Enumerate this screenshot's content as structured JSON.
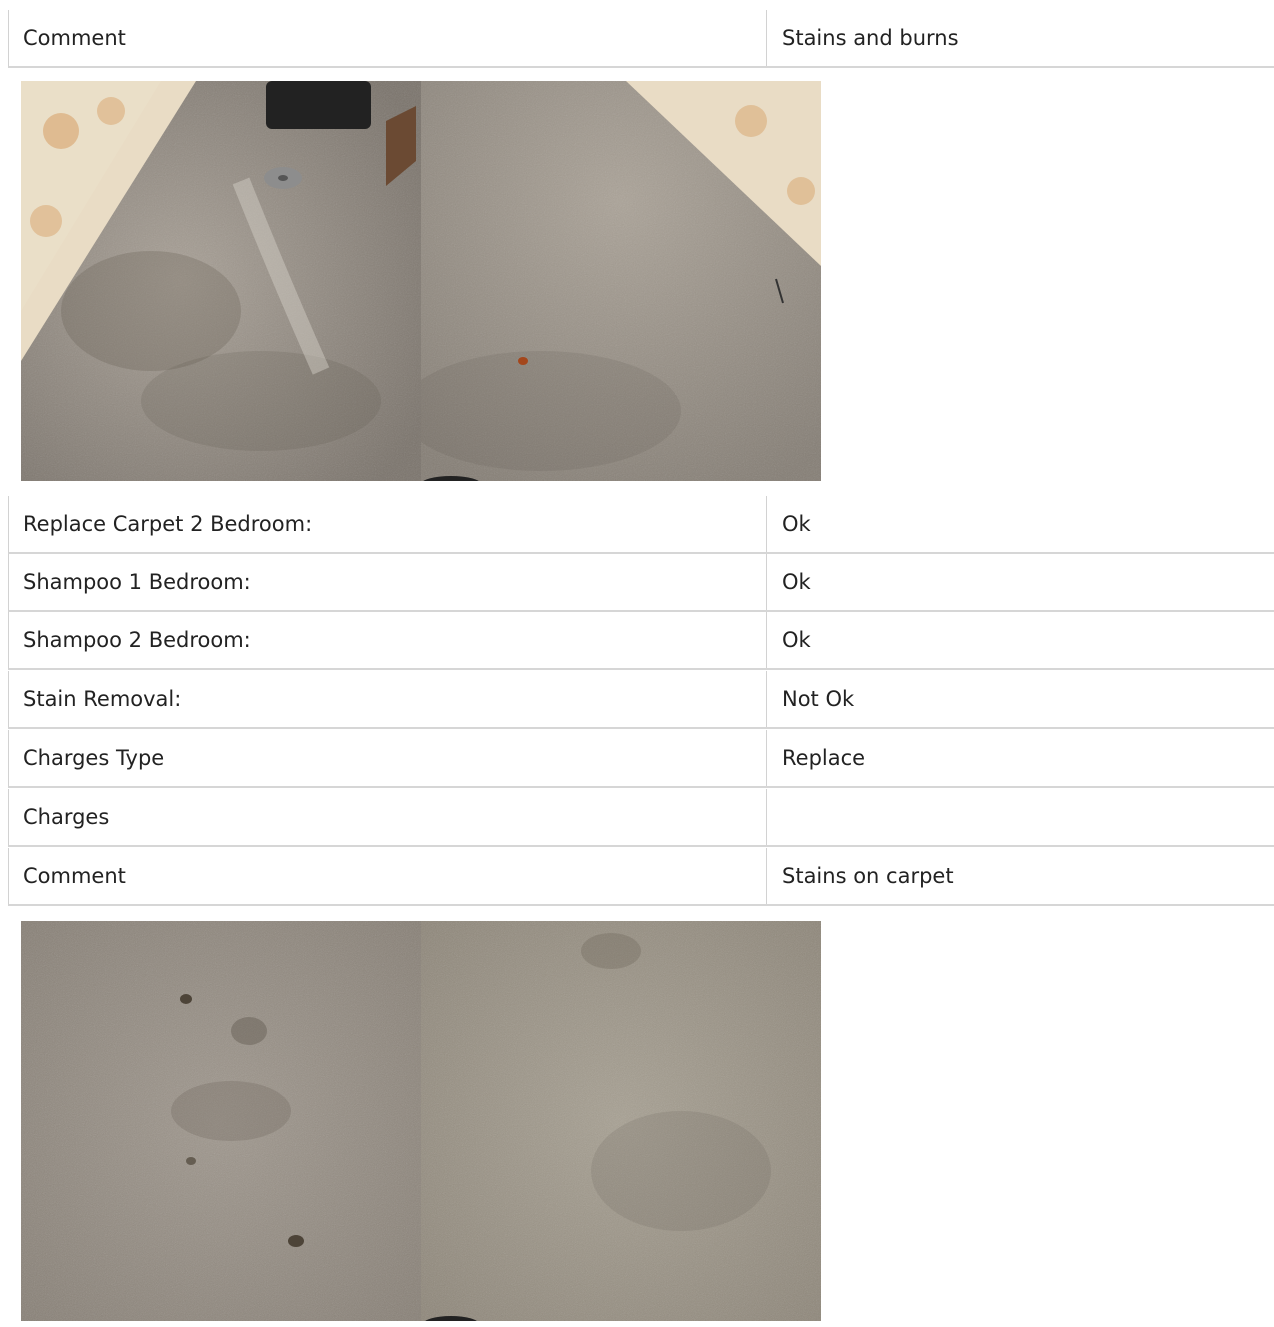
{
  "rows_top": [
    {
      "label": "Comment",
      "value": "Stains and burns"
    }
  ],
  "photos_1": [
    {
      "alt": "carpet-photo-bedroom-left"
    },
    {
      "alt": "carpet-photo-bedroom-right"
    }
  ],
  "rows_middle": [
    {
      "label": "Replace Carpet 2 Bedroom:",
      "value": "Ok"
    },
    {
      "label": "Shampoo 1 Bedroom:",
      "value": "Ok"
    },
    {
      "label": "Shampoo 2 Bedroom:",
      "value": "Ok"
    },
    {
      "label": "Stain Removal:",
      "value": "Not Ok"
    },
    {
      "label": "Charges Type",
      "value": "Replace"
    },
    {
      "label": "Charges",
      "value": ""
    },
    {
      "label": "Comment",
      "value": "Stains on carpet"
    }
  ],
  "colors": {
    "carpet_light": "#a29a91",
    "carpet_dark": "#6f6962",
    "mattress": "#e9dcc5",
    "mattress_accent": "#d7a46c",
    "stain": "#5a5248"
  }
}
